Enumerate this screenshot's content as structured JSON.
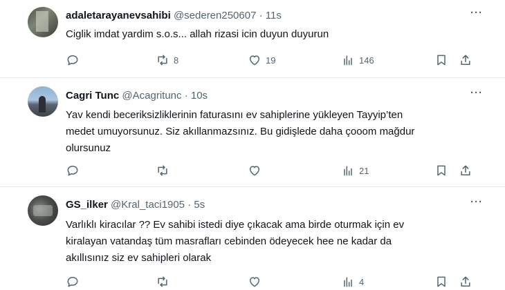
{
  "tweets": [
    {
      "name": "adaletarayanevsahibi",
      "handle": "@sederen250607",
      "sep": "·",
      "time": "11s",
      "more": "···",
      "lines": [
        "Ciglik imdat yardim s.o.s... allah rizasi icin duyun duyurun"
      ],
      "replies": "",
      "retweets": "8",
      "likes": "19",
      "views": "146"
    },
    {
      "name": "Cagri Tunc",
      "handle": "@Acagritunc",
      "sep": "·",
      "time": "10s",
      "more": "···",
      "lines": [
        "Yav kendi beceriksizliklerinin faturasını ev sahiplerine yükleyen Tayyip’ten",
        "medet umuyorsunuz. Siz akıllanmazsınız. Bu gidişlede daha çooom mağdur",
        "olursunuz"
      ],
      "replies": "",
      "retweets": "",
      "likes": "",
      "views": "21"
    },
    {
      "name": "GS_ilker",
      "handle": "@Kral_taci1905",
      "sep": "·",
      "time": "5s",
      "more": "···",
      "lines": [
        "Varlıklı kiracılar ?? Ev sahibi istedi diye çıkacak ama birde oturmak için ev",
        "kiralayan vatandaş tüm masrafları cebinden ödeyecek hee ne kadar da",
        "akıllısınız siz ev sahipleri olarak"
      ],
      "replies": "",
      "retweets": "",
      "likes": "",
      "views": "4"
    }
  ],
  "icons": {
    "reply": "reply-icon",
    "retweet": "retweet-icon",
    "like": "heart-icon",
    "views": "views-chart-icon",
    "bookmark": "bookmark-icon",
    "share": "share-icon",
    "more": "more-dots-icon"
  },
  "colors": {
    "text": "#0f1419",
    "secondary": "#536471",
    "divider": "#e6e9eb"
  }
}
